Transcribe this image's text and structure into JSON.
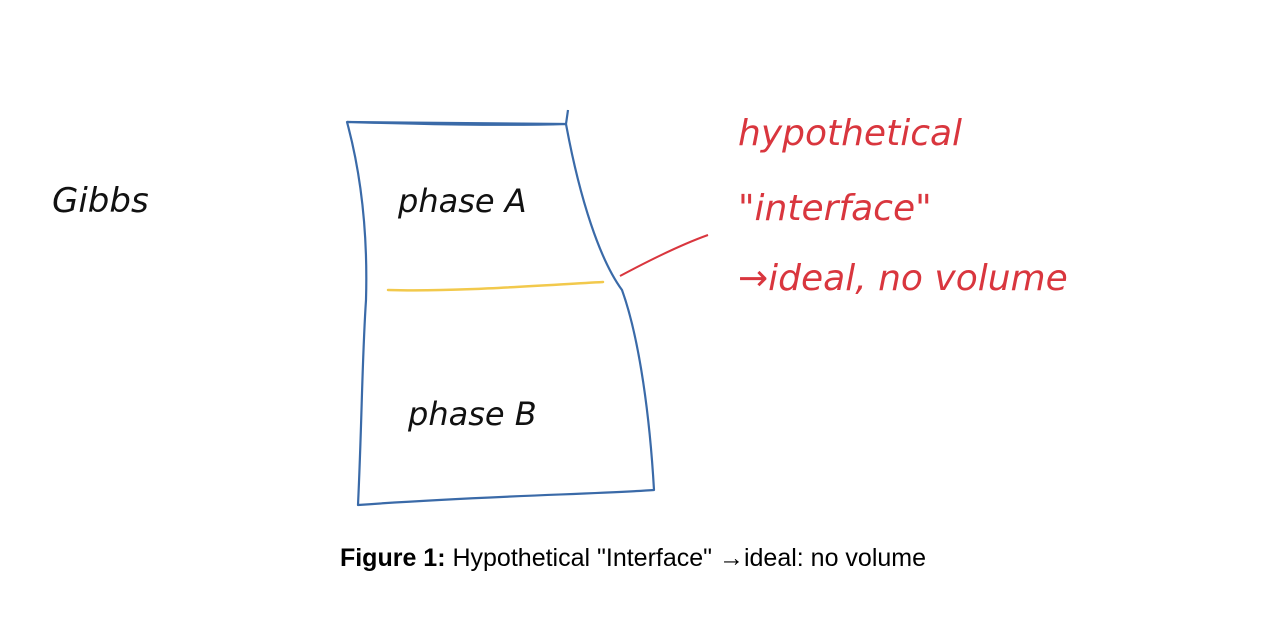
{
  "figure": {
    "labels": {
      "gibbs": "Gibbs",
      "phase_a": "phase A",
      "phase_b": "phase B",
      "annotation_line1": "hypothetical",
      "annotation_line2": "\"interface\"",
      "annotation_line3": "→ideal, no volume"
    },
    "colors": {
      "box": "#3a6aa8",
      "interface": "#f2c94c",
      "annotation": "#d9363e",
      "ink": "#111111"
    }
  },
  "caption": {
    "label": "Figure 1:",
    "text": " Hypothetical \"Interface\" →ideal: no volume"
  }
}
